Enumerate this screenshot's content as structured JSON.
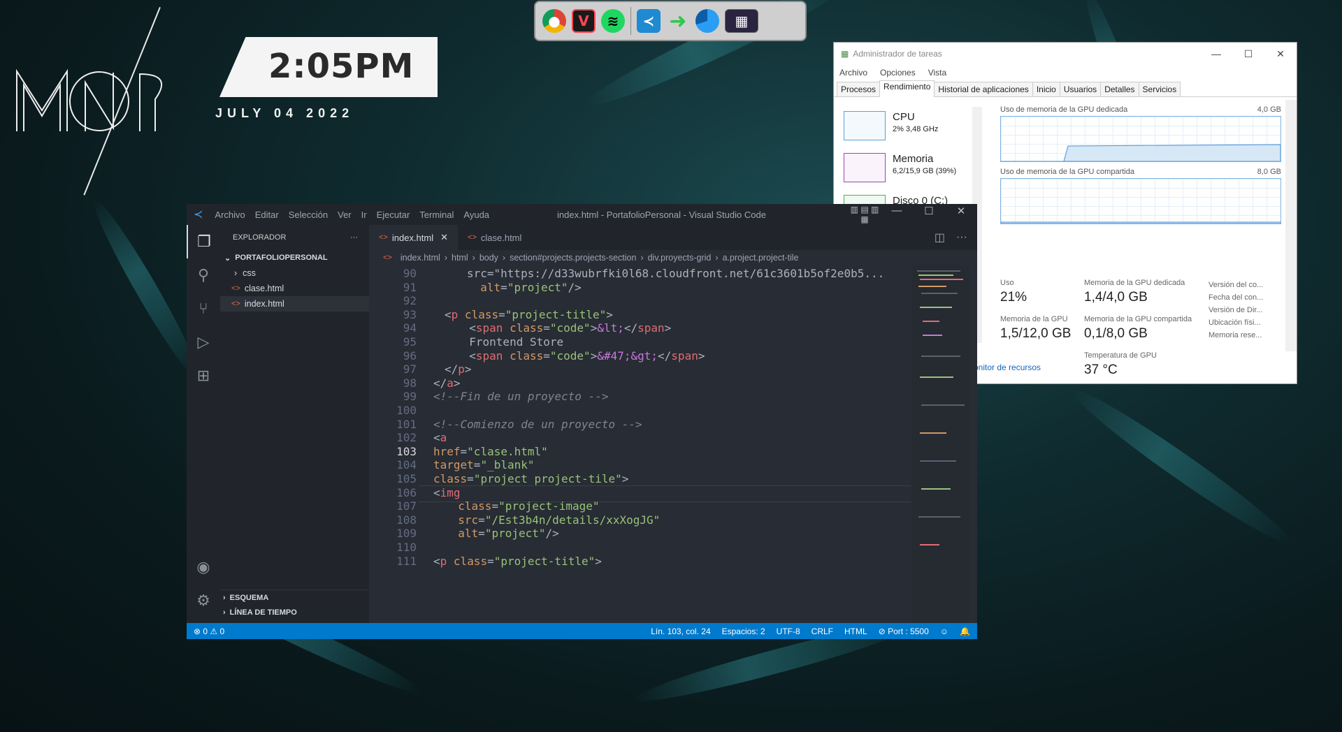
{
  "desktop": {
    "clock_time": "2:05PM",
    "clock_date": "JULY 04 2022",
    "logo_text": "MOR"
  },
  "dock": {
    "icons": [
      "chrome-icon",
      "valorant-icon",
      "spotify-icon",
      "vscode-icon",
      "arrow-icon",
      "pie-app-icon",
      "thumbnail-icon"
    ]
  },
  "taskmanager": {
    "title": "Administrador de tareas",
    "menu": [
      "Archivo",
      "Opciones",
      "Vista"
    ],
    "tabs": [
      "Procesos",
      "Rendimiento",
      "Historial de aplicaciones",
      "Inicio",
      "Usuarios",
      "Detalles",
      "Servicios"
    ],
    "active_tab": "Rendimiento",
    "resources": [
      {
        "name": "CPU",
        "value": "2%  3,48 GHz"
      },
      {
        "name": "Memoria",
        "value": "6,2/15,9 GB (39%)"
      },
      {
        "name": "Disco 0 (C:)",
        "value": ""
      }
    ],
    "graph1_label": "Uso de memoria de la GPU dedicada",
    "graph1_max": "4,0 GB",
    "graph2_label": "Uso de memoria de la GPU compartida",
    "graph2_max": "8,0 GB",
    "stats": {
      "uso_label": "Uso",
      "uso_value": "21%",
      "dedicada_label": "Memoria de la GPU dedicada",
      "dedicada_value": "1,4/4,0 GB",
      "gpu_mem_label": "Memoria de la GPU",
      "gpu_mem_value": "1,5/12,0 GB",
      "compartida_label": "Memoria de la GPU compartida",
      "compartida_value": "0,1/8,0 GB",
      "temp_label": "Temperatura de GPU",
      "temp_value": "37 °C"
    },
    "side_labels": [
      "Versión del co...",
      "Fecha del con...",
      "Versión de Dir...",
      "Ubicación físi...",
      "Memoria rese..."
    ],
    "link": "onitor de recursos"
  },
  "vscode": {
    "menu": [
      "Archivo",
      "Editar",
      "Selección",
      "Ver",
      "Ir",
      "Ejecutar",
      "Terminal",
      "Ayuda"
    ],
    "title": "index.html - PortafolioPersonal - Visual Studio Code",
    "explorer_label": "EXPLORADOR",
    "project": "PORTAFOLIOPERSONAL",
    "tree": [
      "css",
      "clase.html",
      "index.html"
    ],
    "outline": "ESQUEMA",
    "timeline": "LÍNEA DE TIEMPO",
    "tabs": [
      "index.html",
      "clase.html"
    ],
    "breadcrumb": [
      "index.html",
      "html",
      "body",
      "section#projects.projects-section",
      "div.proyects-grid",
      "a.project.project-tile"
    ],
    "lines": [
      {
        "n": "90",
        "t": "src=\"https://d33wubrfki0l68.cloudfront.net/61c3601b5of2e0b5..."
      },
      {
        "n": "91",
        "t": "  alt=\"project\"/>"
      },
      {
        "n": "92",
        "t": ""
      },
      {
        "n": "93",
        "t": "<p class=\"project-title\">"
      },
      {
        "n": "94",
        "t": "  <span class=\"code\">&lt;</span>"
      },
      {
        "n": "95",
        "t": "  Frontend Store"
      },
      {
        "n": "96",
        "t": "  <span class=\"code\">&#47;&gt;</span>"
      },
      {
        "n": "97",
        "t": "</p>"
      },
      {
        "n": "98",
        "t": "</a>"
      },
      {
        "n": "99",
        "t": "<!--Fin de un proyecto -->"
      },
      {
        "n": "100",
        "t": ""
      },
      {
        "n": "101",
        "t": "<!--Comienzo de un proyecto -->"
      },
      {
        "n": "102",
        "t": "<a"
      },
      {
        "n": "103",
        "t": "href=\"clase.html\""
      },
      {
        "n": "104",
        "t": "target=\"_blank\""
      },
      {
        "n": "105",
        "t": "class=\"project project-tile\">"
      },
      {
        "n": "106",
        "t": "<img"
      },
      {
        "n": "107",
        "t": "  class=\"project-image\""
      },
      {
        "n": "108",
        "t": "  src=\"/Est3b4n/details/xxXogJG\""
      },
      {
        "n": "109",
        "t": "  alt=\"project\"/>"
      },
      {
        "n": "110",
        "t": ""
      },
      {
        "n": "111",
        "t": "<p class=\"project-title\">"
      }
    ],
    "status": {
      "problems": "⊗ 0 ⚠ 0",
      "position": "Lín. 103, col. 24",
      "spaces": "Espacios: 2",
      "encoding": "UTF-8",
      "eol": "CRLF",
      "language": "HTML",
      "port": "⊘ Port : 5500"
    }
  }
}
